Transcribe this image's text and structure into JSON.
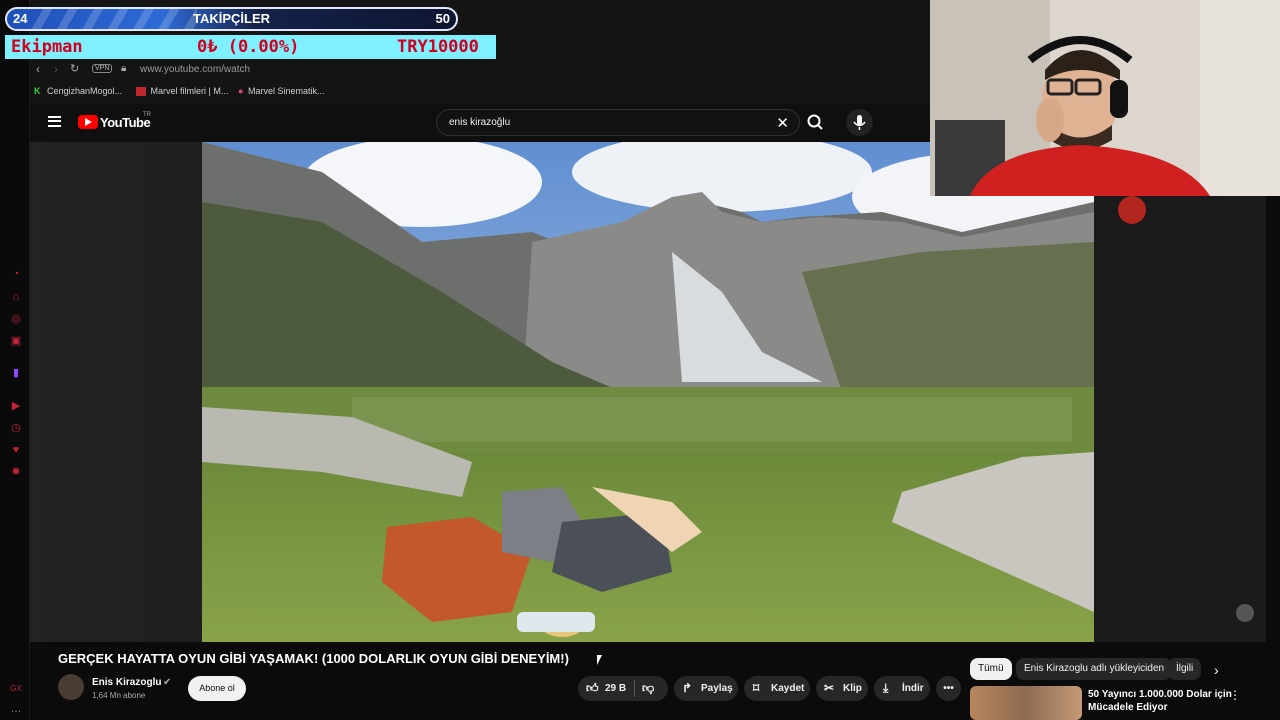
{
  "overlay": {
    "followers_current": "24",
    "followers_label": "TAKİPÇİLER",
    "followers_goal": "50",
    "equip_name": "Ekipman",
    "equip_value": "0₺ (0.00%)",
    "equip_target": "TRY10000"
  },
  "browser": {
    "vpn_badge": "VPN",
    "url": "www.youtube.com/watch",
    "bookmarks": [
      {
        "label": "CengizhanMogol..."
      },
      {
        "label": "Marvel filmleri | M..."
      },
      {
        "label": "Marvel Sinematik..."
      }
    ]
  },
  "youtube": {
    "logo_text": "YouTube",
    "region": "TR",
    "search_value": "enis kirazoğlu",
    "video_title": "GERÇEK HAYATTA OYUN GİBİ YAŞAMAK! (1000 DOLARLIK OYUN GİBİ DENEYİM!)",
    "channel_name": "Enis Kirazoglu",
    "subscribers": "1,64 Mn abone",
    "subscribe_label": "Abone ol",
    "like_count": "29 B",
    "share_label": "Paylaş",
    "save_label": "Kaydet",
    "clip_label": "Klip",
    "download_label": "İndir",
    "chips": [
      "Tümü",
      "Enis Kirazoglu adlı yükleyiciden",
      "İlgili"
    ],
    "rec_title_line1": "50 Yayıncı 1.000.000 Dolar için",
    "rec_title_line2": "Mücadele Ediyor"
  },
  "colors": {
    "accent_red": "#c0233b",
    "equip_bg": "#7ff0ff",
    "equip_text": "#d1001f",
    "followers_blue": "#2e6bd6"
  }
}
